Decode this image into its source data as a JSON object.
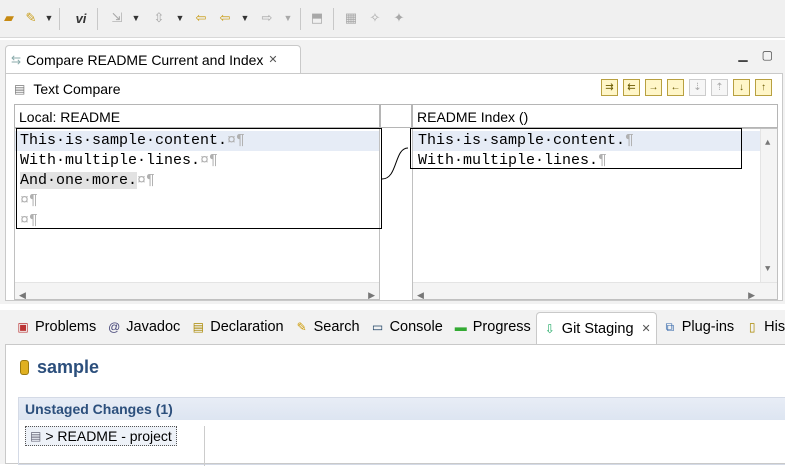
{
  "toolbar": {
    "icons": [
      "open-folder-icon",
      "pin-icon",
      "dropdown-arrow",
      "diff-icon",
      "external-tool-icon",
      "dropdown-arrow",
      "next-annotation-icon",
      "dropdown-arrow",
      "back-icon",
      "previous-icon",
      "dropdown-arrow",
      "forward-icon",
      "dropdown-arrow",
      "pin-editor-icon",
      "grid-icon",
      "wand-icon",
      "wand2-icon"
    ]
  },
  "editor": {
    "tab_title": "Compare README Current and Index",
    "compare_title": "Text Compare",
    "left": {
      "header": "Local: README",
      "lines": [
        {
          "text": "This is sample content.",
          "marks": "¤¶"
        },
        {
          "text": "With multiple lines.",
          "marks": "¤¶"
        },
        {
          "text": "And one more.",
          "marks": "¤¶"
        },
        {
          "text": "",
          "marks": "¤¶"
        },
        {
          "text": "",
          "marks": "¤¶"
        }
      ]
    },
    "right": {
      "header": "README Index ()",
      "lines": [
        {
          "text": "This is sample content.",
          "marks": "¶"
        },
        {
          "text": "With multiple lines.",
          "marks": "¶"
        }
      ]
    }
  },
  "views": {
    "tabs": [
      {
        "label": "Problems",
        "icon": "problems-icon"
      },
      {
        "label": "Javadoc",
        "icon": "javadoc-icon"
      },
      {
        "label": "Declaration",
        "icon": "declaration-icon"
      },
      {
        "label": "Search",
        "icon": "search-icon"
      },
      {
        "label": "Console",
        "icon": "console-icon"
      },
      {
        "label": "Progress",
        "icon": "progress-icon"
      },
      {
        "label": "Git Staging",
        "icon": "git-staging-icon",
        "active": true
      },
      {
        "label": "Plug-ins",
        "icon": "plugin-icon"
      },
      {
        "label": "Hist",
        "icon": "history-icon"
      }
    ],
    "project_name": "sample",
    "unstaged_header": "Unstaged Changes (1)",
    "unstaged_item": "> README - project"
  },
  "colors": {
    "accent": "#2c4f7c",
    "section_bg": "#e3e9f3",
    "diff_line": "#e6ecf6"
  }
}
